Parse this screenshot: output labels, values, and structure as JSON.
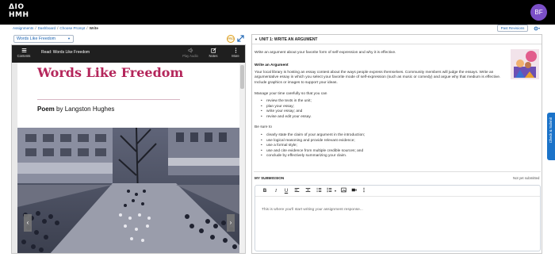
{
  "brand": {
    "logo_line1": "ΔΙΟ",
    "logo_line2": "HMH"
  },
  "user": {
    "initials": "BF"
  },
  "breadcrumb": {
    "items": [
      "Assignments",
      "Dashboard",
      "Choose Prompt"
    ],
    "current": "Write"
  },
  "header": {
    "past_revisions_label": "Past Revisions"
  },
  "reader": {
    "selected_text": "Words Like Freedom",
    "pro_badge": "PRO",
    "toolbar": {
      "contents_label": "Contents",
      "read_title": "Read: Words Like Freedom",
      "play_audio_label": "Play Audio",
      "notes_label": "Notes",
      "more_label": "More"
    },
    "page": {
      "title": "Words Like Freedom",
      "author_prefix": "Poem",
      "author_by": "by Langston Hughes"
    }
  },
  "assignment": {
    "unit_heading": "UNIT 1: WRITE AN ARGUMENT",
    "intro": "Write an argument about your favorite form of self-expression and why it is effective.",
    "section_title": "Write an Argument",
    "paragraph": "Your local library is hosting an essay contest about the ways people express themselves. Community members will judge the essays. Write an argumentative essay in which you select your favorite mode of self-expression (such as music or comedy) and argue why that medium is effective. Include graphics or images to support your ideas.",
    "plan_intro": "Manage your time carefully so that you can",
    "plan_items": [
      "review the texts in the unit;",
      "plan your essay;",
      "write your essay; and",
      "revise and edit your essay."
    ],
    "sure_intro": "Be sure to",
    "sure_items": [
      "clearly state the claim of your argument in the introduction;",
      "use logical reasoning and provide relevant evidence;",
      "use a formal style;",
      "use and cite evidence from multiple credible sources; and",
      "conclude by effectively summarizing your claim."
    ]
  },
  "submission": {
    "label": "MY SUBMISSION",
    "status": "Not yet submitted",
    "placeholder": "This is where you'll start writing your assignment response..."
  },
  "side_tab": {
    "label": "Check & Submit"
  },
  "colors": {
    "accent": "#1b64b3",
    "brand_magenta": "#b4265b",
    "avatar": "#7b4fc7",
    "topbar": "#000000"
  }
}
